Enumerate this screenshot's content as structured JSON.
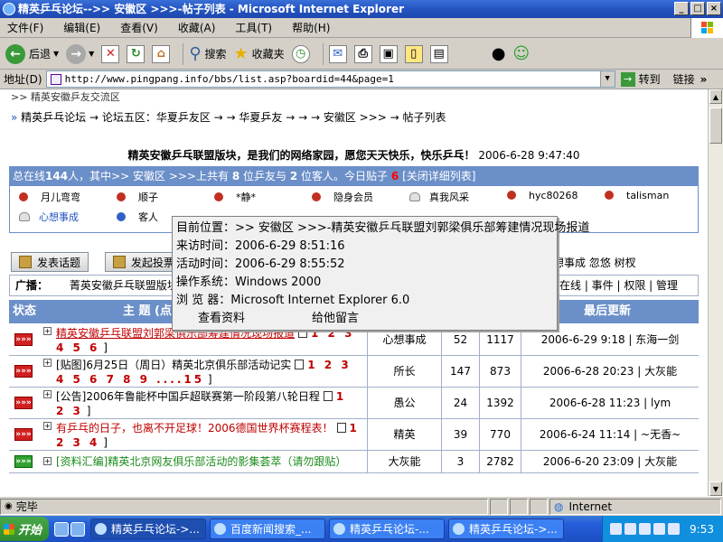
{
  "window": {
    "title": "精英乒乓论坛-->> 安徽区 >>>-帖子列表 - Microsoft Internet Explorer",
    "min": "_",
    "max": "□",
    "close": "×"
  },
  "menu": [
    "文件(F)",
    "编辑(E)",
    "查看(V)",
    "收藏(A)",
    "工具(T)",
    "帮助(H)"
  ],
  "toolbar": {
    "back": "后退",
    "search": "搜索",
    "favorites": "收藏夹"
  },
  "address": {
    "label": "地址(D)",
    "url": "http://www.pingpang.info/bbs/list.asp?boardid=44&page=1",
    "go": "转到",
    "links": "链接"
  },
  "page": {
    "top_cut": ">> 精英安徽乒友交流区",
    "breadcrumb": "精英乒乓论坛 → 论坛五区：华夏乒友区 → → 华夏乒友 → → → 安徽区 >>> → 帖子列表",
    "headline": "精英安徽乒乓联盟版块，是我们的网络家园，愿您天天快乐，快乐乒乓！",
    "headline_time": "2006-6-28 9:47:40",
    "online_pre": "总在线",
    "online_total": "144",
    "online_mid": "人，其中>> 安徽区 >>>上共有",
    "online_friends": "8",
    "online_mid2": "位乒友与",
    "online_guests": "2",
    "online_mid3": "位客人。今日贴子",
    "today_posts": "6",
    "online_link": "[关闭详细列表]",
    "users": [
      "月儿弯弯",
      "顺子",
      "*静*",
      "隐身会员",
      "真我风采",
      "hyc80268",
      "talisman",
      "心想事成",
      "客人"
    ],
    "post_button": "发表话题",
    "poll_button": "发起投票",
    "right_links": "心想事成 忽悠 树杈",
    "ad_label": "广播：",
    "ad_text": "菁英安徽乒乓联盟版块",
    "ad_nav": "在线 | 事件 | 权限 | 管理",
    "thead": {
      "status": "状态",
      "topic": "主 题 (点",
      "last": "最后更新"
    }
  },
  "threads": [
    {
      "status": "»»»",
      "title": "精英安徽乒乓联盟刘郭梁俱乐部筹建情况现场报道",
      "pages": "1 2 3 4 5 6",
      "author": "心想事成",
      "replies": "52",
      "views": "1117",
      "last": "2006-6-29 9:18 | 东海一剑"
    },
    {
      "status": "»»»",
      "title": "[贴图]6月25日（周日）精英北京俱乐部活动记实",
      "pages": "1 2 3 4 5 6 7 8 9 ....15",
      "author": "所长",
      "replies": "147",
      "views": "873",
      "last": "2006-6-28 20:23 | 大灰能"
    },
    {
      "status": "»»»",
      "title": "[公告]2006年鲁能杯中国乒超联赛第一阶段第八轮日程",
      "pages": "1 2 3",
      "author": "愚公",
      "replies": "24",
      "views": "1392",
      "last": "2006-6-28 11:23 | lym"
    },
    {
      "status": "»»»",
      "title": "有乒乓的日子，也离不开足球！2006德国世界杯赛程表！",
      "pages": "1 2 3 4",
      "author": "精英",
      "replies": "39",
      "views": "770",
      "last": "2006-6-24 11:14 | ~无香~"
    },
    {
      "status": "»»»",
      "title": "[资料汇编]精英北京网友俱乐部活动的影集荟萃（请勿跟贴）",
      "pages": "",
      "author": "大灰能",
      "replies": "3",
      "views": "2782",
      "last": "2006-6-20 23:09 | 大灰能"
    }
  ],
  "tooltip": {
    "location": "目前位置：>> 安徽区 >>>-精英安徽乒乓联盟刘郭梁俱乐部筹建情况现场报道",
    "visit": "来访时间：2006-6-29 8:51:16",
    "active": "活动时间：2006-6-29 8:55:52",
    "os": "操作系统：Windows 2000",
    "browser": "浏 览 器：Microsoft Internet Explorer 6.0",
    "view_profile": "查看资料",
    "leave_message": "给他留言"
  },
  "status": {
    "text": "完毕",
    "zone": "Internet"
  },
  "taskbar": {
    "start": "开始",
    "tasks": [
      "精英乒乓论坛->...",
      "百度新闻搜索_...",
      "精英乒乓论坛-...",
      "精英乒乓论坛->..."
    ],
    "clock": "9:53"
  }
}
